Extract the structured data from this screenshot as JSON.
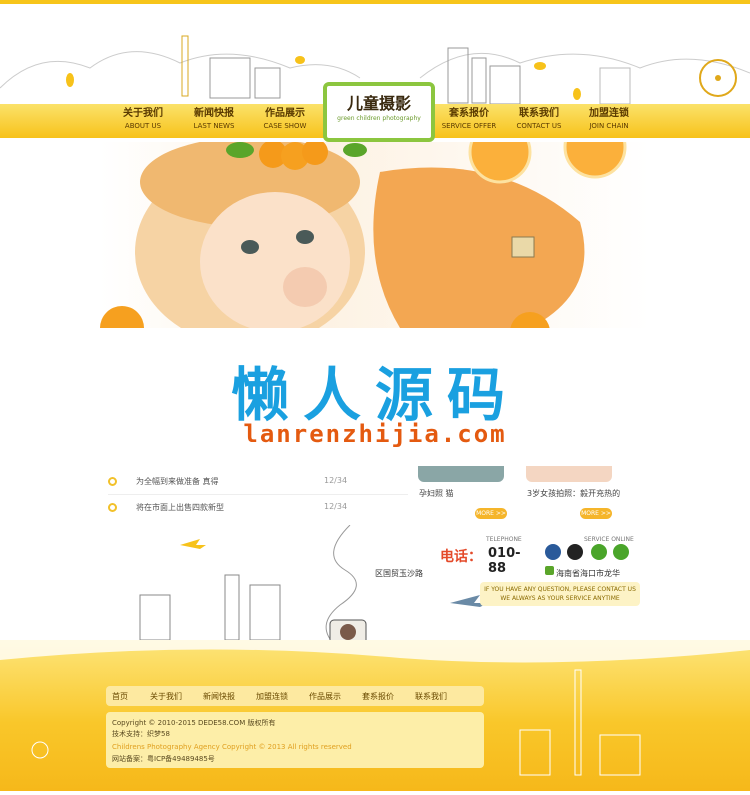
{
  "header": {
    "logo_title": "儿童摄影",
    "logo_subtitle": "green children photography",
    "nav_left": [
      {
        "cn": "关于我们",
        "en": "ABOUT US"
      },
      {
        "cn": "新闻快报",
        "en": "LAST NEWS"
      },
      {
        "cn": "作品展示",
        "en": "CASE SHOW"
      }
    ],
    "nav_right": [
      {
        "cn": "套系报价",
        "en": "SERVICE OFFER"
      },
      {
        "cn": "联系我们",
        "en": "CONTACT US"
      },
      {
        "cn": "加盟连锁",
        "en": "JOIN CHAIN"
      }
    ]
  },
  "watermark": {
    "cn": "懒人源码",
    "en": "lanrenzhijia.com"
  },
  "news": [
    {
      "title": "为全幅到来做准备 真得",
      "date": "12/34"
    },
    {
      "title": "将在市面上出售四款新型",
      "date": "12/34"
    }
  ],
  "works": {
    "caption_1": "孕妇照 猫",
    "caption_2": "3岁女孩拍照：毅开充热的",
    "more_label": "MORE >>"
  },
  "contact": {
    "telephone_en": "TELEPHONE",
    "telephone_label": "电话：",
    "telephone_number": "010-88",
    "service_en": "SERVICE ONLINE",
    "address": "海南省海口市龙华",
    "road_label": "区国贸玉沙路",
    "slogan_line1": "IF YOU HAVE ANY QUESTION, PLEASE CONTACT US",
    "slogan_line2": "WE ALWAYS AS YOUR SERVICE ANYTIME"
  },
  "footer": {
    "links": [
      "首页",
      "关于我们",
      "新闻快报",
      "加盟连锁",
      "作品展示",
      "套系报价",
      "联系我们"
    ],
    "copyright": "Copyright © 2010-2015 DEDE58.COM 版权所有",
    "support": "技术支持：织梦58",
    "copyright_en": "Childrens Photography Agency Copyright © 2013 All rights reserved",
    "icp": "网站备案：粤ICP备49489485号"
  },
  "colors": {
    "accent_yellow": "#f7c21a",
    "orange": "#f5a623",
    "watermark_blue": "#1aa0e0",
    "watermark_orange": "#e45a10"
  }
}
